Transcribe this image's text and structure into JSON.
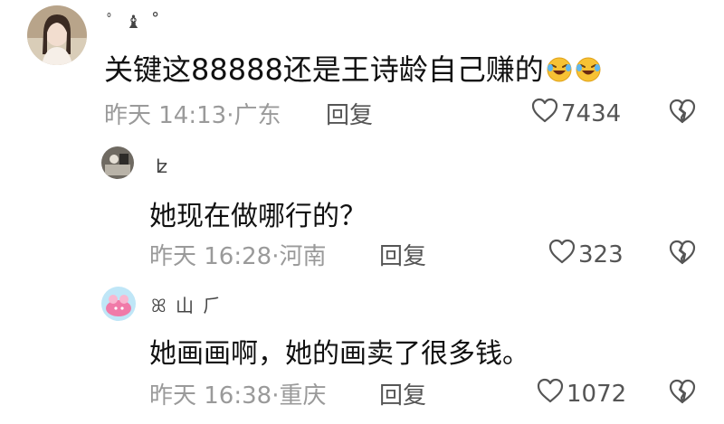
{
  "comments": [
    {
      "username": "ﾟ ♝  ˚",
      "text": "关键这88888还是王诗龄自己赚的",
      "emoji": [
        "rolling-on-floor-laughing",
        "rolling-on-floor-laughing"
      ],
      "meta": "昨天 14:13·广东",
      "reply_label": "回复",
      "likes": "7434"
    },
    {
      "username": "ʫ",
      "text": "她现在做哪行的？",
      "meta": "昨天 16:28·河南",
      "reply_label": "回复",
      "likes": "323"
    },
    {
      "username": "ꕤ 山   ⺁",
      "text": "她画画啊，她的画卖了很多钱。",
      "meta": "昨天 16:38·重庆",
      "reply_label": "回复",
      "likes": "1072"
    }
  ],
  "colors": {
    "text": "#111111",
    "meta": "#9a9a9a",
    "icon": "#555555"
  }
}
